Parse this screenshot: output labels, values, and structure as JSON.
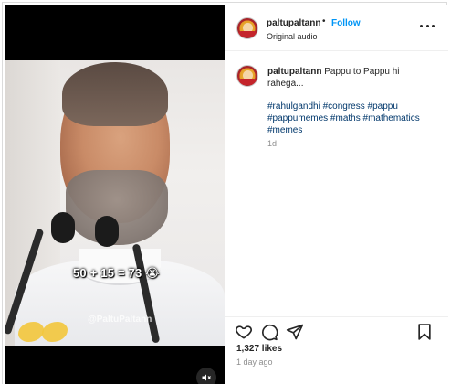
{
  "post": {
    "username": "paltupaltann",
    "follow_label": "Follow",
    "separator": "•",
    "audio_label": "Original audio",
    "caption_text": "Pappu to Pappu hi rahega...",
    "hashtags": "#rahulgandhi #congress #pappu #pappumemes #maths #mathematics #memes",
    "caption_age": "1d",
    "likes": "1,327 likes",
    "posted_ago": "1 day ago"
  },
  "video": {
    "overlay_caption": "50 + 15 = 73 😭",
    "watermark": "@PaltuPaltann"
  },
  "icons": {
    "more": "more-options-icon",
    "like": "heart-icon",
    "comment": "comment-icon",
    "share": "share-icon",
    "save": "bookmark-icon",
    "mute": "muted-speaker-icon"
  },
  "colors": {
    "accent": "#0095f6",
    "hashtag": "#00376b",
    "muted_text": "#8e8e8e"
  }
}
